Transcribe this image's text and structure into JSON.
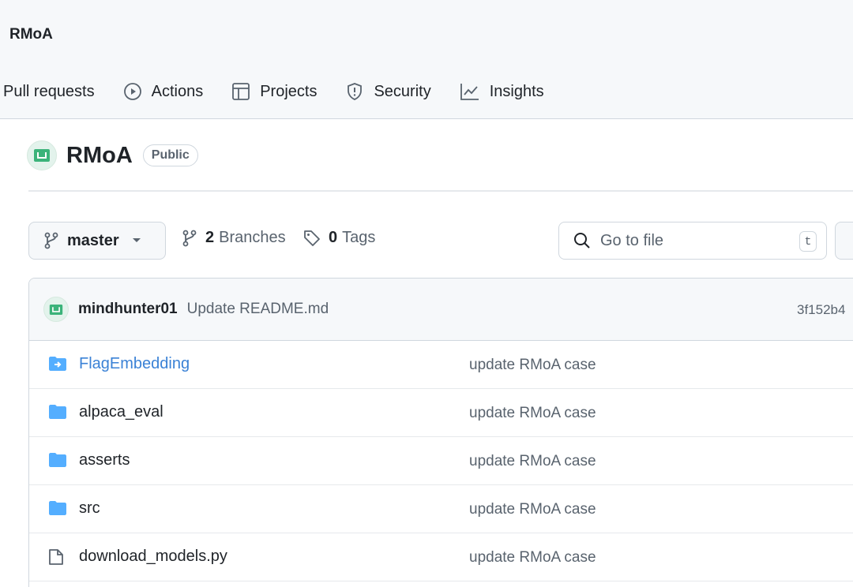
{
  "header": {
    "owner": "RMoA",
    "nav": [
      {
        "label": "Pull requests",
        "icon": "pull-request-icon"
      },
      {
        "label": "Actions",
        "icon": "play-icon"
      },
      {
        "label": "Projects",
        "icon": "table-icon"
      },
      {
        "label": "Security",
        "icon": "shield-icon"
      },
      {
        "label": "Insights",
        "icon": "graph-icon"
      }
    ]
  },
  "repo": {
    "name": "RMoA",
    "visibility": "Public"
  },
  "toolbar": {
    "branch": "master",
    "branches_count": "2",
    "branches_label": "Branches",
    "tags_count": "0",
    "tags_label": "Tags",
    "search_placeholder": "Go to file",
    "search_shortcut": "t"
  },
  "commit": {
    "author": "mindhunter01",
    "message": "Update README.md",
    "sha": "3f152b4"
  },
  "files": [
    {
      "name": "FlagEmbedding",
      "type": "submodule",
      "message": "update RMoA case"
    },
    {
      "name": "alpaca_eval",
      "type": "folder",
      "message": "update RMoA case"
    },
    {
      "name": "asserts",
      "type": "folder",
      "message": "update RMoA case"
    },
    {
      "name": "src",
      "type": "folder",
      "message": "update RMoA case"
    },
    {
      "name": "download_models.py",
      "type": "file",
      "message": "update RMoA case"
    }
  ],
  "colors": {
    "folder": "#54aeff",
    "link": "#3b82d6",
    "avatar_bg": "#e3f3ec",
    "avatar_fg": "#3bb37a"
  }
}
